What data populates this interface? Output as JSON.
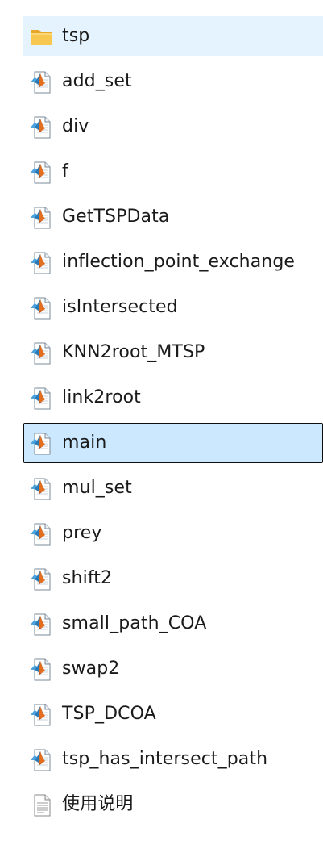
{
  "files": [
    {
      "name": "tsp",
      "type": "folder",
      "icon": "folder-icon",
      "state": "hover"
    },
    {
      "name": "add_set",
      "type": "matlab",
      "icon": "matlab-file-icon",
      "state": ""
    },
    {
      "name": "div",
      "type": "matlab",
      "icon": "matlab-file-icon",
      "state": ""
    },
    {
      "name": "f",
      "type": "matlab",
      "icon": "matlab-file-icon",
      "state": ""
    },
    {
      "name": "GetTSPData",
      "type": "matlab",
      "icon": "matlab-file-icon",
      "state": ""
    },
    {
      "name": "inflection_point_exchange",
      "type": "matlab",
      "icon": "matlab-file-icon",
      "state": ""
    },
    {
      "name": "isIntersected",
      "type": "matlab",
      "icon": "matlab-file-icon",
      "state": ""
    },
    {
      "name": "KNN2root_MTSP",
      "type": "matlab",
      "icon": "matlab-file-icon",
      "state": ""
    },
    {
      "name": "link2root",
      "type": "matlab",
      "icon": "matlab-file-icon",
      "state": ""
    },
    {
      "name": "main",
      "type": "matlab",
      "icon": "matlab-file-icon",
      "state": "selected"
    },
    {
      "name": "mul_set",
      "type": "matlab",
      "icon": "matlab-file-icon",
      "state": ""
    },
    {
      "name": "prey",
      "type": "matlab",
      "icon": "matlab-file-icon",
      "state": ""
    },
    {
      "name": "shift2",
      "type": "matlab",
      "icon": "matlab-file-icon",
      "state": ""
    },
    {
      "name": "small_path_COA",
      "type": "matlab",
      "icon": "matlab-file-icon",
      "state": ""
    },
    {
      "name": "swap2",
      "type": "matlab",
      "icon": "matlab-file-icon",
      "state": ""
    },
    {
      "name": "TSP_DCOA",
      "type": "matlab",
      "icon": "matlab-file-icon",
      "state": ""
    },
    {
      "name": "tsp_has_intersect_path",
      "type": "matlab",
      "icon": "matlab-file-icon",
      "state": ""
    },
    {
      "name": "使用说明",
      "type": "text",
      "icon": "text-file-icon",
      "state": ""
    }
  ],
  "colors": {
    "hover_bg": "#e5f3ff",
    "selected_bg": "#cce8ff",
    "selected_border": "#0f0f0f",
    "folder": "#f8c74f",
    "matlab_orange": "#e36f1e"
  }
}
